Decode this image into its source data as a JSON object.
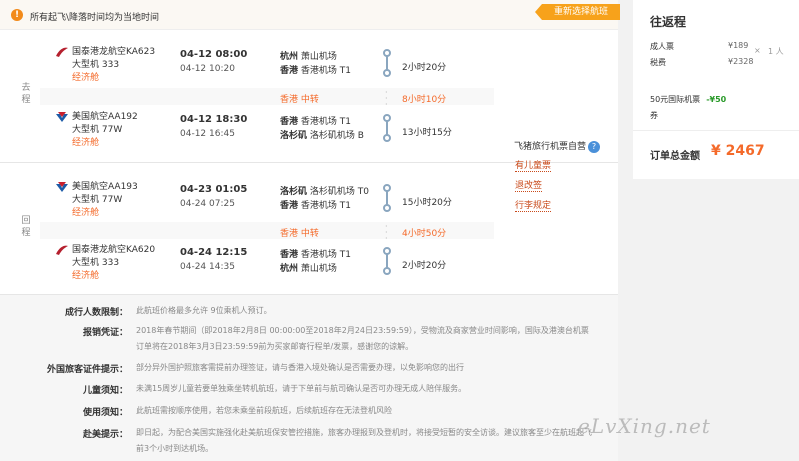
{
  "notice": {
    "icon": "!",
    "text": "所有起飞\\降落时间均为当地时间"
  },
  "reselect_label": "重新选择航班",
  "segments": [
    {
      "label": "去程",
      "legs": [
        {
          "airline": "国泰港龙航空KA623",
          "plane": "大型机 333",
          "cabin": "经济舱",
          "dep_time": "04-12 08:00",
          "arr_time": "04-12 10:20",
          "dep_city": "杭州",
          "dep_airport": "萧山机场",
          "arr_city": "香港",
          "arr_airport": "香港机场 T1",
          "duration": "2小时20分",
          "logo": "cathay-logo"
        },
        {
          "airline": "美国航空AA192",
          "plane": "大型机 77W",
          "cabin": "经济舱",
          "dep_time": "04-12 18:30",
          "arr_time": "04-12 16:45",
          "dep_city": "香港",
          "dep_airport": "香港机场 T1",
          "arr_city": "洛杉矶",
          "arr_airport": "洛杉矶机场 B",
          "duration": "13小时15分",
          "logo": "american-airlines-logo"
        }
      ],
      "transfer": {
        "city": "香港 中转",
        "wait": "8小时10分"
      }
    },
    {
      "label": "回程",
      "legs": [
        {
          "airline": "美国航空AA193",
          "plane": "大型机 77W",
          "cabin": "经济舱",
          "dep_time": "04-23 01:05",
          "arr_time": "04-24 07:25",
          "dep_city": "洛杉矶",
          "dep_airport": "洛杉矶机场 T0",
          "arr_city": "香港",
          "arr_airport": "香港机场 T1",
          "duration": "15小时20分",
          "logo": "american-airlines-logo"
        },
        {
          "airline": "国泰港龙航空KA620",
          "plane": "大型机 333",
          "cabin": "经济舱",
          "dep_time": "04-24 12:15",
          "arr_time": "04-24 14:35",
          "dep_city": "香港",
          "dep_airport": "香港机场 T1",
          "arr_city": "杭州",
          "arr_airport": "萧山机场",
          "duration": "2小时20分",
          "logo": "cathay-logo"
        }
      ],
      "transfer": {
        "city": "香港 中转",
        "wait": "4小时50分"
      }
    }
  ],
  "vendor": {
    "name": "飞猪旅行机票自营",
    "links": [
      "有儿童票",
      "退改签",
      "行李规定"
    ]
  },
  "rules": [
    {
      "key": "成行人数限制：",
      "value": "此航班价格最多允许 9位乘机人预订。"
    },
    {
      "key": "报销凭证：",
      "value": "2018年春节期间（即2018年2月8日 00:00:00至2018年2月24日23:59:59），受物流及商家营业时间影响，国际及港澳台机票订单将在2018年3月3日23:59:59前为买家邮寄行程单/发票，感谢您的谅解。"
    },
    {
      "key": "外国旅客证件提示：",
      "value": "部分异外国护照旅客需提前办理签证，请与香港入境处确认是否需要办理，以免影响您的出行"
    },
    {
      "key": "儿童须知：",
      "value": "未满15周岁儿童若要单独乘坐转机航班，请于下单前与航司确认是否可办理无成人陪伴服务。"
    },
    {
      "key": "使用须知：",
      "value": "此航班需按顺序使用，若您未乘坐前段航班，后续航班存在无法登机风险"
    },
    {
      "key": "赴美提示：",
      "value": "即日起，为配合美国实施强化赴美航班保安管控措施，旅客办理报到及登机时，将接受短暂的安全访谈。建议旅客至少在航班起飞前3个小时到达机场。"
    }
  ],
  "summary": {
    "title": "往返程",
    "adult_label": "成人票",
    "adult_price": "¥189",
    "multiply": "×",
    "count": "1 人",
    "tax_label": "税费",
    "tax_price": "¥2328",
    "coupon_label": "50元国际机票",
    "coupon_value": "-¥50",
    "coupon_suffix": "券",
    "total_label": "订单总金额",
    "total_value": "¥ 2467"
  },
  "watermark": "eLvXing.net",
  "colors": {
    "accent": "#f46a2a",
    "reselect": "#f7a21b",
    "route": "#8aa6bf",
    "coupon": "#2a9a2a"
  }
}
